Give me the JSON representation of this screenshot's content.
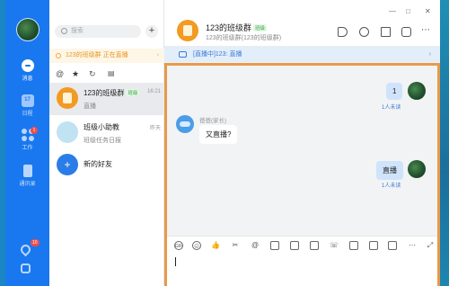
{
  "rail": {
    "items": [
      {
        "label": "消息",
        "icon": "message-icon"
      },
      {
        "label": "日程",
        "icon": "calendar-icon"
      },
      {
        "label": "工作",
        "icon": "workbench-icon",
        "badge": "1"
      },
      {
        "label": "通讯录",
        "icon": "contacts-icon"
      }
    ],
    "bottom_badge": "10"
  },
  "list": {
    "search_placeholder": "搜索",
    "add_label": "+",
    "live_banner": "123的班级群 正在直播",
    "live_arrow": "›",
    "conversations": [
      {
        "name": "123的班级群",
        "tag": "班级",
        "sub": "直播",
        "time": "16:21"
      },
      {
        "name": "班级小助教",
        "sub": "班级任务日报",
        "time": "昨天"
      },
      {
        "name": "新的好友",
        "sub": ""
      }
    ]
  },
  "chat": {
    "title": "123的班级群",
    "tag": "班级",
    "subtitle": "123的班级群(123的班级群)",
    "window": {
      "minimize": "—",
      "maximize": "□",
      "close": "✕"
    },
    "live_bar": "[直播中]123: 直播",
    "live_arrow": "›",
    "messages": [
      {
        "from": "me",
        "text": "1",
        "status": "1人未读"
      },
      {
        "from": "other",
        "sender": "爸爸(家长)",
        "text": "又直播?"
      },
      {
        "from": "me",
        "text": "直播",
        "status": "1人未读"
      }
    ]
  }
}
